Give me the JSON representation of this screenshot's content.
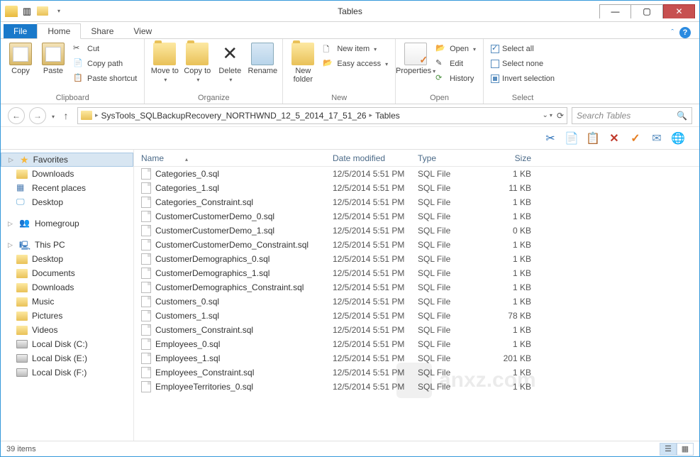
{
  "window": {
    "title": "Tables"
  },
  "tabs": {
    "file": "File",
    "home": "Home",
    "share": "Share",
    "view": "View"
  },
  "ribbon": {
    "clipboard": {
      "label": "Clipboard",
      "copy": "Copy",
      "paste": "Paste",
      "cut": "Cut",
      "copy_path": "Copy path",
      "paste_shortcut": "Paste shortcut"
    },
    "organize": {
      "label": "Organize",
      "move_to": "Move to",
      "copy_to": "Copy to",
      "delete": "Delete",
      "rename": "Rename"
    },
    "new": {
      "label": "New",
      "new_folder": "New folder",
      "new_item": "New item",
      "easy_access": "Easy access"
    },
    "open": {
      "label": "Open",
      "properties": "Properties",
      "open": "Open",
      "edit": "Edit",
      "history": "History"
    },
    "select": {
      "label": "Select",
      "select_all": "Select all",
      "select_none": "Select none",
      "invert": "Invert selection"
    }
  },
  "breadcrumb": {
    "folder": "SysTools_SQLBackupRecovery_NORTHWND_12_5_2014_17_51_26",
    "current": "Tables"
  },
  "search": {
    "placeholder": "Search Tables"
  },
  "nav": {
    "favorites": "Favorites",
    "downloads": "Downloads",
    "recent": "Recent places",
    "desktop": "Desktop",
    "homegroup": "Homegroup",
    "thispc": "This PC",
    "pc_desktop": "Desktop",
    "documents": "Documents",
    "pc_downloads": "Downloads",
    "music": "Music",
    "pictures": "Pictures",
    "videos": "Videos",
    "local_c": "Local Disk (C:)",
    "local_e": "Local Disk (E:)",
    "local_f": "Local Disk (F:)"
  },
  "columns": {
    "name": "Name",
    "date": "Date modified",
    "type": "Type",
    "size": "Size"
  },
  "files": [
    {
      "name": "Categories_0.sql",
      "date": "12/5/2014 5:51 PM",
      "type": "SQL File",
      "size": "1 KB"
    },
    {
      "name": "Categories_1.sql",
      "date": "12/5/2014 5:51 PM",
      "type": "SQL File",
      "size": "11 KB"
    },
    {
      "name": "Categories_Constraint.sql",
      "date": "12/5/2014 5:51 PM",
      "type": "SQL File",
      "size": "1 KB"
    },
    {
      "name": "CustomerCustomerDemo_0.sql",
      "date": "12/5/2014 5:51 PM",
      "type": "SQL File",
      "size": "1 KB"
    },
    {
      "name": "CustomerCustomerDemo_1.sql",
      "date": "12/5/2014 5:51 PM",
      "type": "SQL File",
      "size": "0 KB"
    },
    {
      "name": "CustomerCustomerDemo_Constraint.sql",
      "date": "12/5/2014 5:51 PM",
      "type": "SQL File",
      "size": "1 KB"
    },
    {
      "name": "CustomerDemographics_0.sql",
      "date": "12/5/2014 5:51 PM",
      "type": "SQL File",
      "size": "1 KB"
    },
    {
      "name": "CustomerDemographics_1.sql",
      "date": "12/5/2014 5:51 PM",
      "type": "SQL File",
      "size": "1 KB"
    },
    {
      "name": "CustomerDemographics_Constraint.sql",
      "date": "12/5/2014 5:51 PM",
      "type": "SQL File",
      "size": "1 KB"
    },
    {
      "name": "Customers_0.sql",
      "date": "12/5/2014 5:51 PM",
      "type": "SQL File",
      "size": "1 KB"
    },
    {
      "name": "Customers_1.sql",
      "date": "12/5/2014 5:51 PM",
      "type": "SQL File",
      "size": "78 KB"
    },
    {
      "name": "Customers_Constraint.sql",
      "date": "12/5/2014 5:51 PM",
      "type": "SQL File",
      "size": "1 KB"
    },
    {
      "name": "Employees_0.sql",
      "date": "12/5/2014 5:51 PM",
      "type": "SQL File",
      "size": "1 KB"
    },
    {
      "name": "Employees_1.sql",
      "date": "12/5/2014 5:51 PM",
      "type": "SQL File",
      "size": "201 KB"
    },
    {
      "name": "Employees_Constraint.sql",
      "date": "12/5/2014 5:51 PM",
      "type": "SQL File",
      "size": "1 KB"
    },
    {
      "name": "EmployeeTerritories_0.sql",
      "date": "12/5/2014 5:51 PM",
      "type": "SQL File",
      "size": "1 KB"
    }
  ],
  "status": {
    "count": "39 items"
  }
}
